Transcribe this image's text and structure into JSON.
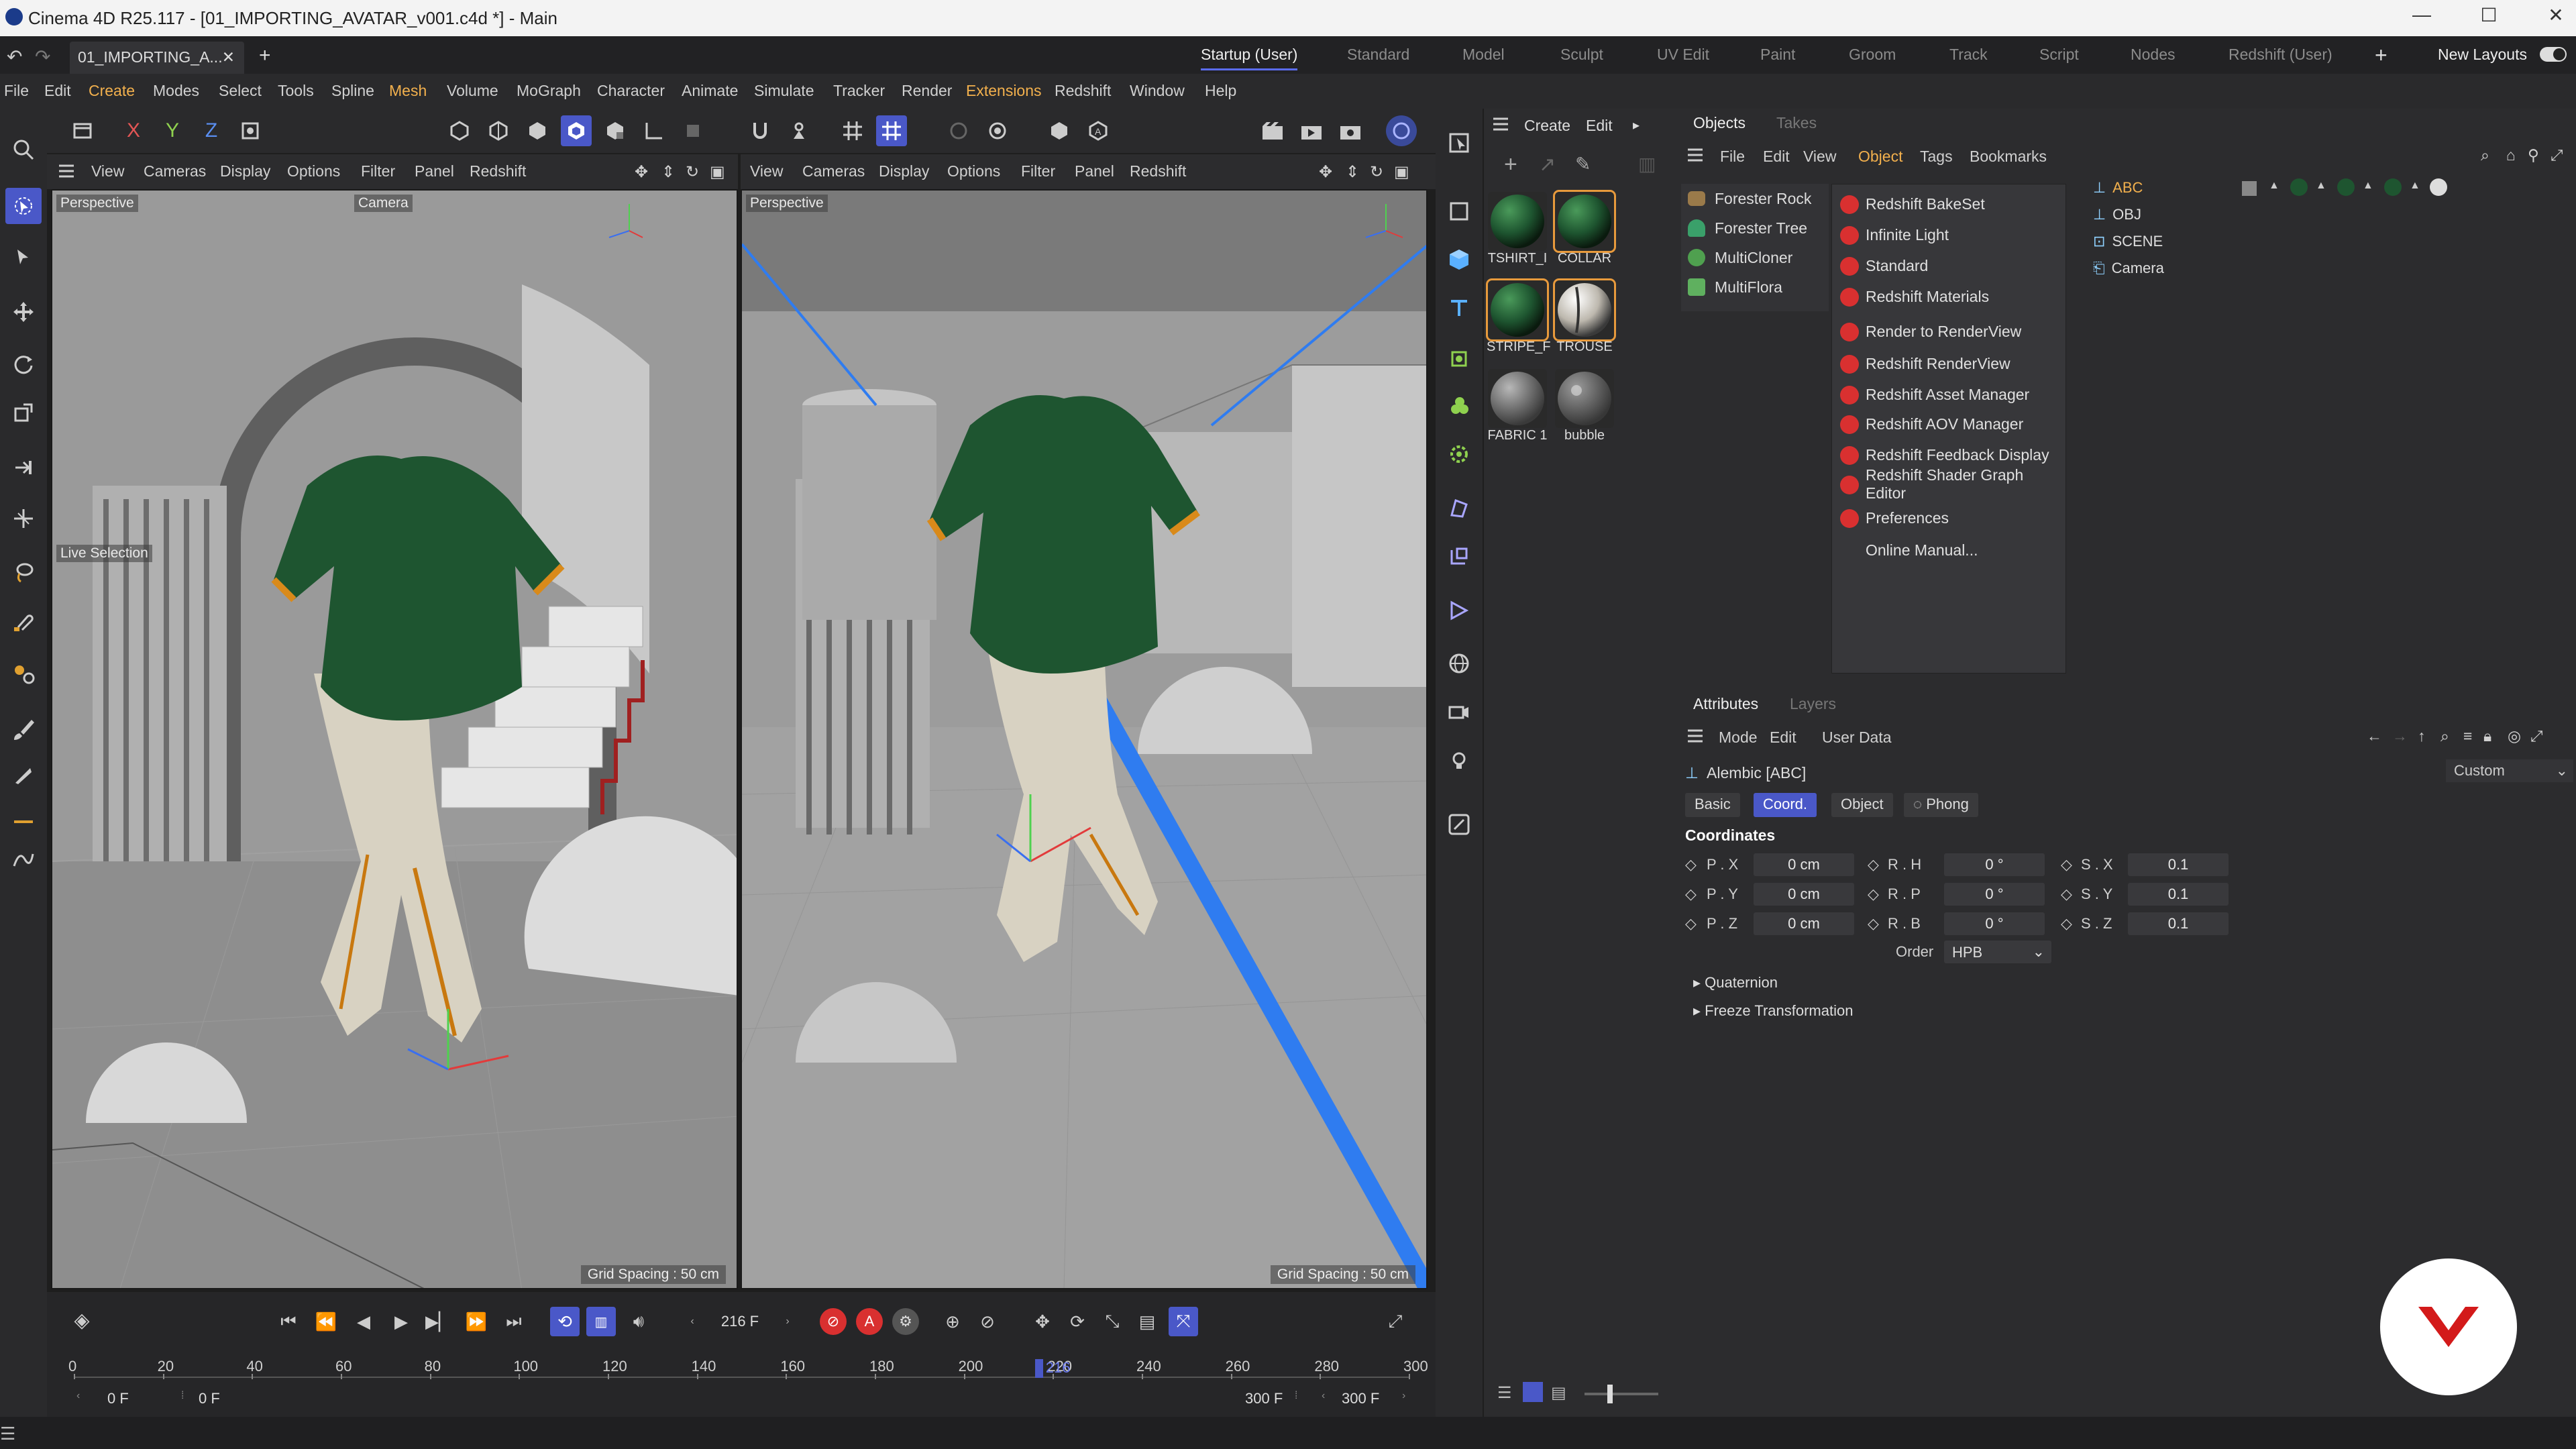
{
  "window": {
    "title": "Cinema 4D R25.117 - [01_IMPORTING_AVATAR_v001.c4d *] - Main",
    "doc_tab": "01_IMPORTING_A...",
    "minimize": "—",
    "maximize": "☐",
    "close": "✕"
  },
  "layouts": [
    "Startup (User)",
    "Standard",
    "Model",
    "Sculpt",
    "UV Edit",
    "Paint",
    "Groom",
    "Track",
    "Script",
    "Nodes",
    "Redshift (User)"
  ],
  "new_layouts": "New Layouts",
  "menu": [
    "File",
    "Edit",
    "Create",
    "Modes",
    "Select",
    "Tools",
    "Spline",
    "Mesh",
    "Volume",
    "MoGraph",
    "Character",
    "Animate",
    "Simulate",
    "Tracker",
    "Render",
    "Extensions",
    "Redshift",
    "Window",
    "Help"
  ],
  "axis_labels": {
    "x": "X",
    "y": "Y",
    "z": "Z"
  },
  "viewport_menu": [
    "View",
    "Cameras",
    "Display",
    "Options",
    "Filter",
    "Panel",
    "Redshift"
  ],
  "viewport_left": {
    "label": "Perspective",
    "camera": "Camera",
    "hud": "Live Selection",
    "grid": "Grid Spacing : 50 cm"
  },
  "viewport_right": {
    "label": "Perspective",
    "grid": "Grid Spacing : 50 cm"
  },
  "material_menu": {
    "create": "Create",
    "edit": "Edit"
  },
  "materials": [
    {
      "name": "TSHIRT_I",
      "color": "#1f5a2c"
    },
    {
      "name": "COLLAR",
      "color": "#1f5a2c"
    },
    {
      "name": "STRIPE_F",
      "color": "#1f5a2c"
    },
    {
      "name": "TROUSE",
      "color": "#e8e4dc"
    },
    {
      "name": "FABRIC 1",
      "color": "#7a7a7a"
    },
    {
      "name": "bubble",
      "color": "#9a9a9a"
    }
  ],
  "objects_tabs": {
    "objects": "Objects",
    "takes": "Takes"
  },
  "objects_menu": [
    "File",
    "Edit",
    "View",
    "Object",
    "Tags",
    "Bookmarks"
  ],
  "forester_items": [
    "Forester Rock",
    "Forester Tree",
    "MultiCloner",
    "MultiFlora"
  ],
  "redshift_menu": [
    "Redshift BakeSet",
    "Infinite Light",
    "Standard",
    "Redshift Materials",
    "Render to RenderView",
    "Redshift RenderView",
    "Redshift Asset Manager",
    "Redshift AOV Manager",
    "Redshift Feedback Display",
    "Redshift Shader Graph Editor",
    "Preferences",
    "Online Manual..."
  ],
  "objects": [
    "ABC",
    "OBJ",
    "SCENE",
    "Camera"
  ],
  "attr_tabs": {
    "attributes": "Attributes",
    "layers": "Layers"
  },
  "attr_menu": [
    "Mode",
    "Edit",
    "User Data"
  ],
  "attr_object": "Alembic [ABC]",
  "attr_preset": "Custom",
  "attr_subtabs": [
    "Basic",
    "Coord.",
    "Object",
    "Phong"
  ],
  "coordinates": {
    "heading": "Coordinates",
    "px": {
      "label": "P . X",
      "value": "0 cm"
    },
    "py": {
      "label": "P . Y",
      "value": "0 cm"
    },
    "pz": {
      "label": "P . Z",
      "value": "0 cm"
    },
    "rh": {
      "label": "R . H",
      "value": "0 °"
    },
    "rp": {
      "label": "R . P",
      "value": "0 °"
    },
    "rb": {
      "label": "R . B",
      "value": "0 °"
    },
    "sx": {
      "label": "S . X",
      "value": "0.1"
    },
    "sy": {
      "label": "S . Y",
      "value": "0.1"
    },
    "sz": {
      "label": "S . Z",
      "value": "0.1"
    },
    "order_label": "Order",
    "order_value": "HPB"
  },
  "sections": [
    "Quaternion",
    "Freeze Transformation"
  ],
  "timeline": {
    "current_frame": "216 F",
    "ruler": [
      "0",
      "20",
      "40",
      "60",
      "80",
      "100",
      "120",
      "140",
      "160",
      "180",
      "200",
      "220",
      "240",
      "260",
      "280",
      "300"
    ],
    "playhead_value": 216,
    "playhead_label": "216",
    "start": "0 F",
    "min": "0 F",
    "max": "300 F",
    "end": "300 F"
  }
}
